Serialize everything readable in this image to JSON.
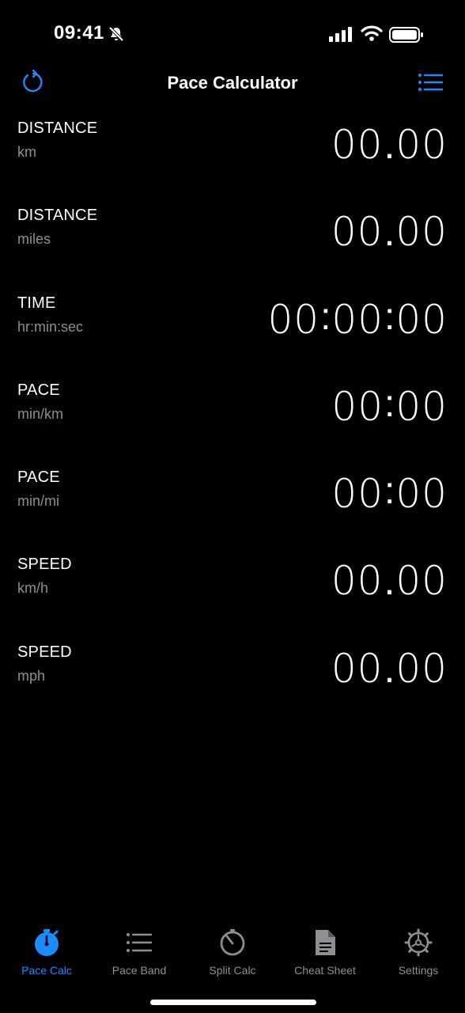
{
  "status_bar": {
    "time": "09:41"
  },
  "nav": {
    "title": "Pace Calculator"
  },
  "rows": [
    {
      "label": "DISTANCE",
      "unit": "km",
      "left": "00",
      "sep": ".",
      "right": "00"
    },
    {
      "label": "DISTANCE",
      "unit": "miles",
      "left": "00",
      "sep": ".",
      "right": "00"
    },
    {
      "label": "TIME",
      "unit": "hr:min:sec",
      "hours": "00",
      "minutes": "00",
      "seconds": "00"
    },
    {
      "label": "PACE",
      "unit": "min/km",
      "left": "00",
      "sep": ":",
      "right": "00"
    },
    {
      "label": "PACE",
      "unit": "min/mi",
      "left": "00",
      "sep": ":",
      "right": "00"
    },
    {
      "label": "SPEED",
      "unit": "km/h",
      "left": "00",
      "sep": ".",
      "right": "00"
    },
    {
      "label": "SPEED",
      "unit": "mph",
      "left": "00",
      "sep": ".",
      "right": "00"
    }
  ],
  "tabs": [
    {
      "label": "Pace Calc",
      "icon": "stopwatch-icon",
      "active": true
    },
    {
      "label": "Pace Band",
      "icon": "list-icon"
    },
    {
      "label": "Split Calc",
      "icon": "timer-icon"
    },
    {
      "label": "Cheat Sheet",
      "icon": "document-icon"
    },
    {
      "label": "Settings",
      "icon": "gear-icon"
    }
  ],
  "colors": {
    "accent": "#1a8cff",
    "inactive": "#8e8e93",
    "background": "#000000"
  }
}
